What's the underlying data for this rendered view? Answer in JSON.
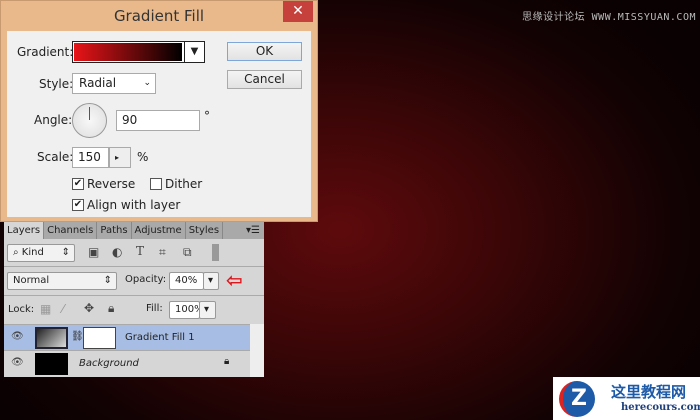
{
  "dialog": {
    "title": "Gradient Fill",
    "close": "✕",
    "gradient_label": "Gradient:",
    "gradient_colors": [
      "#e81418",
      "#000000"
    ],
    "ok": "OK",
    "cancel": "Cancel",
    "style_label": "Style:",
    "style_value": "Radial",
    "angle_label": "Angle:",
    "angle_value": "90",
    "angle_unit": "°",
    "scale_label": "Scale:",
    "scale_value": "150",
    "scale_unit": "%",
    "reverse": "Reverse",
    "reverse_checked": true,
    "dither": "Dither",
    "dither_checked": false,
    "align": "Align with layer",
    "align_checked": true
  },
  "layers": {
    "tabs": [
      "Layers",
      "Channels",
      "Paths",
      "Adjustme",
      "Styles"
    ],
    "kind": "Kind",
    "blend": "Normal",
    "opacity_label": "Opacity:",
    "opacity_value": "40%",
    "lock_label": "Lock:",
    "fill_label": "Fill:",
    "fill_value": "100%",
    "items": [
      {
        "name": "Gradient Fill 1",
        "selected": true
      },
      {
        "name": "Background",
        "locked": true
      }
    ]
  },
  "watermark": "思缘设计论坛 WWW.MISSYUAN.COM",
  "logo": {
    "title": "这里教程网",
    "url": "herecours.com"
  },
  "colors": {
    "arrow": "#e0141a",
    "selected_layer": "#a8bde3"
  }
}
